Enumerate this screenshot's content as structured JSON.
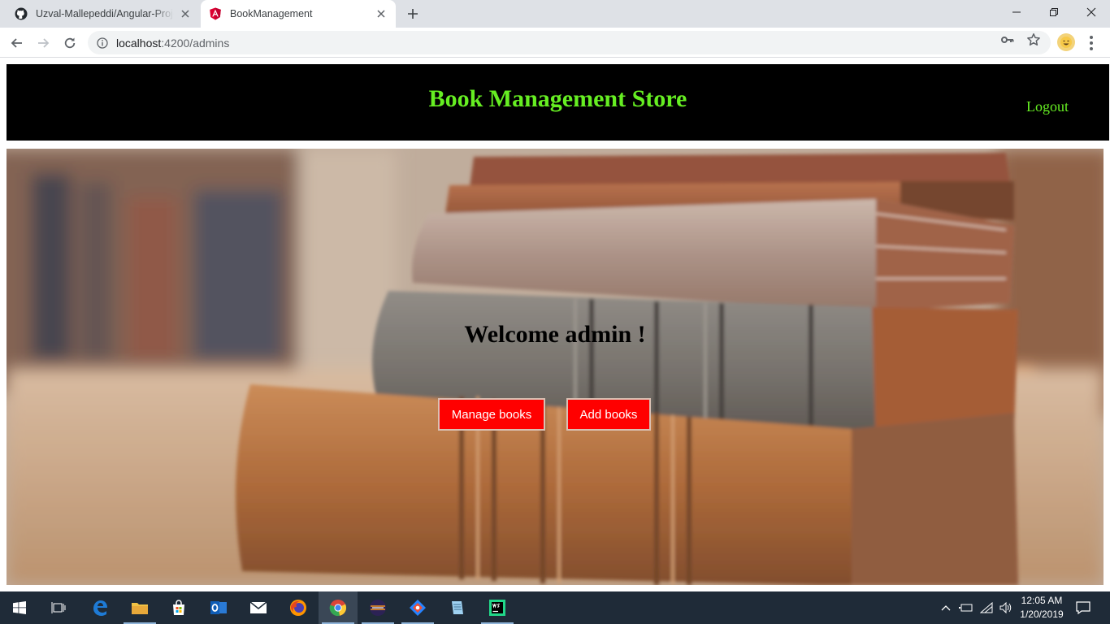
{
  "browser": {
    "tabs": [
      {
        "title": "Uzval-Mallepeddi/Angular-Project",
        "favicon": "github-icon",
        "active": false
      },
      {
        "title": "BookManagement",
        "favicon": "angular-icon",
        "active": true
      }
    ],
    "url_host": "localhost",
    "url_path": ":4200/admins"
  },
  "header": {
    "brand": "Book Management Store",
    "logout_label": "Logout",
    "brand_color": "#66ee22",
    "background": "#000000"
  },
  "hero": {
    "welcome": "Welcome admin !",
    "buttons": {
      "manage": "Manage books",
      "add": "Add books"
    },
    "button_color": "#ff0000",
    "image": "stack-of-old-books-photo"
  },
  "taskbar": {
    "time": "12:05 AM",
    "date": "1/20/2019",
    "apps": [
      "start-icon",
      "task-view-icon",
      "edge-icon",
      "file-explorer-icon",
      "store-icon",
      "outlook-icon",
      "mail-icon",
      "firefox-icon",
      "chrome-icon",
      "eclipse-icon",
      "sourcetree-icon",
      "notepad-icon",
      "webstorm-icon"
    ]
  }
}
